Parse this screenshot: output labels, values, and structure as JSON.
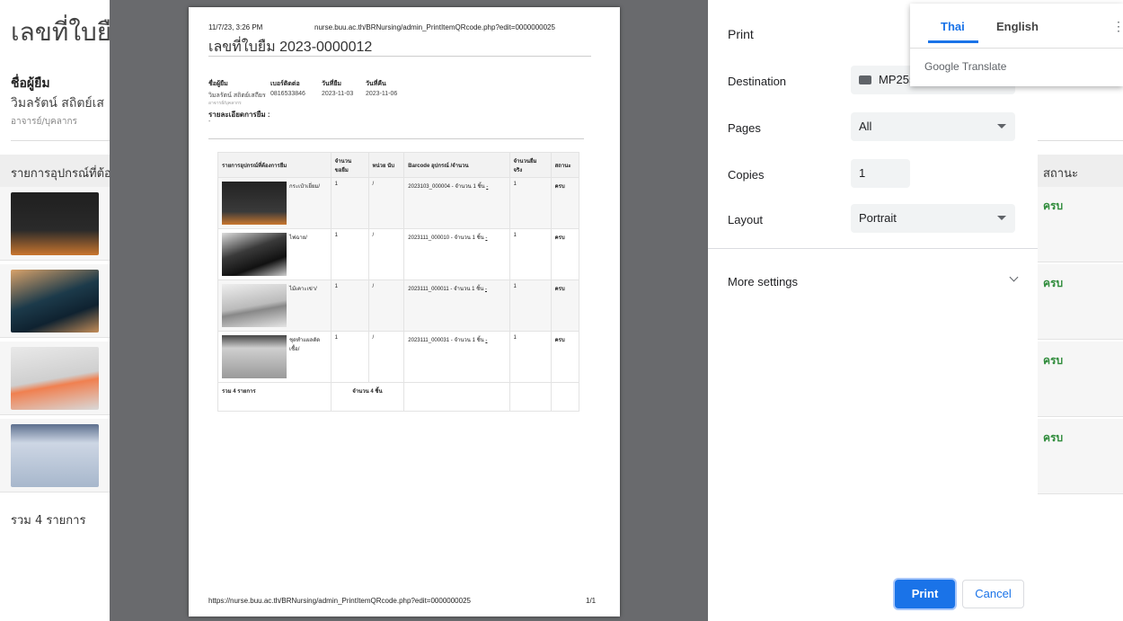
{
  "background": {
    "title": "เลขที่ใบยื",
    "borrower_label": "ชื่อผู้ยืม",
    "borrower_name": "วิมลรัตน์ สถิตย์เส",
    "borrower_role": "อาจารย์/บุคลากร",
    "list_header": "รายการอุปกรณ์ที่ต้อ",
    "total_label": "รวม 4 รายการ",
    "status_header": "สถานะ",
    "statuses": [
      "ครบ",
      "ครบ",
      "ครบ",
      "ครบ"
    ]
  },
  "preview": {
    "header_date": "11/7/23, 3:26 PM",
    "header_url": "nurse.buu.ac.th/BRNursing/admin_PrintItemQRcode.php?edit=0000000025",
    "title": "เลขที่ใบยืม 2023-0000012",
    "info": {
      "borrower_label": "ชื่อผู้ยืม",
      "borrower_value": "วิมลรัตน์ สถิตย์เสถียร",
      "contact_label": "เบอร์ติดต่อ",
      "contact_value": "0816533846",
      "borrow_date_label": "วันที่ยืม",
      "borrow_date_value": "2023-11-03",
      "return_date_label": "วันที่คืน",
      "return_date_value": "2023-11-06",
      "role": "อาจารย์/บุคลากร"
    },
    "details_label": "รายละเอียดการยืม :",
    "details_value": "-",
    "table": {
      "headers": [
        "รายการอุปกรณ์ที่ต้องการยืม",
        "จำนวน ขอยืม",
        "หน่วย นับ",
        "Barcode อุปกรณ์ /จำนวน",
        "จำนวนยืม จริง",
        "สถานะ"
      ],
      "rows": [
        {
          "name": "กระเป๋าเยี่ยม/",
          "qty": "1",
          "unit": "/",
          "barcode": "2023103_000004 - จำนวน 1 ชิ้น",
          "actual": "1",
          "status": "ครบ"
        },
        {
          "name": "ไฟฉาย/",
          "qty": "1",
          "unit": "/",
          "barcode": "2023111_000010 - จำนวน 1 ชิ้น",
          "actual": "1",
          "status": "ครบ"
        },
        {
          "name": "ไม้เคาะเข่า/",
          "qty": "1",
          "unit": "/",
          "barcode": "2023111_000011 - จำนวน 1 ชิ้น",
          "actual": "1",
          "status": "ครบ"
        },
        {
          "name": "ชุดทำแผลตัด เชื้อ/",
          "qty": "1",
          "unit": "/",
          "barcode": "2023111_000031 - จำนวน 1 ชิ้น",
          "actual": "1",
          "status": "ครบ"
        }
      ],
      "barcode_suffix": "-",
      "total_items": "รวม 4 รายการ",
      "total_qty": "จำนวน 4 ชิ้น"
    },
    "footer_url": "https://nurse.buu.ac.th/BRNursing/admin_PrintItemQRcode.php?edit=0000000025",
    "footer_page": "1/1"
  },
  "panel": {
    "title": "Print",
    "destination_label": "Destination",
    "destination_value": "MP255",
    "pages_label": "Pages",
    "pages_value": "All",
    "copies_label": "Copies",
    "copies_value": "1",
    "layout_label": "Layout",
    "layout_value": "Portrait",
    "more_settings": "More settings",
    "print_button": "Print",
    "cancel_button": "Cancel"
  },
  "translate": {
    "tab_thai": "Thai",
    "tab_english": "English",
    "brand": "Google Translate",
    "menu": "⋮"
  },
  "colors": {
    "accent": "#1a73e8",
    "status_green": "#2e8b3a",
    "preview_bg": "#696a6d"
  }
}
